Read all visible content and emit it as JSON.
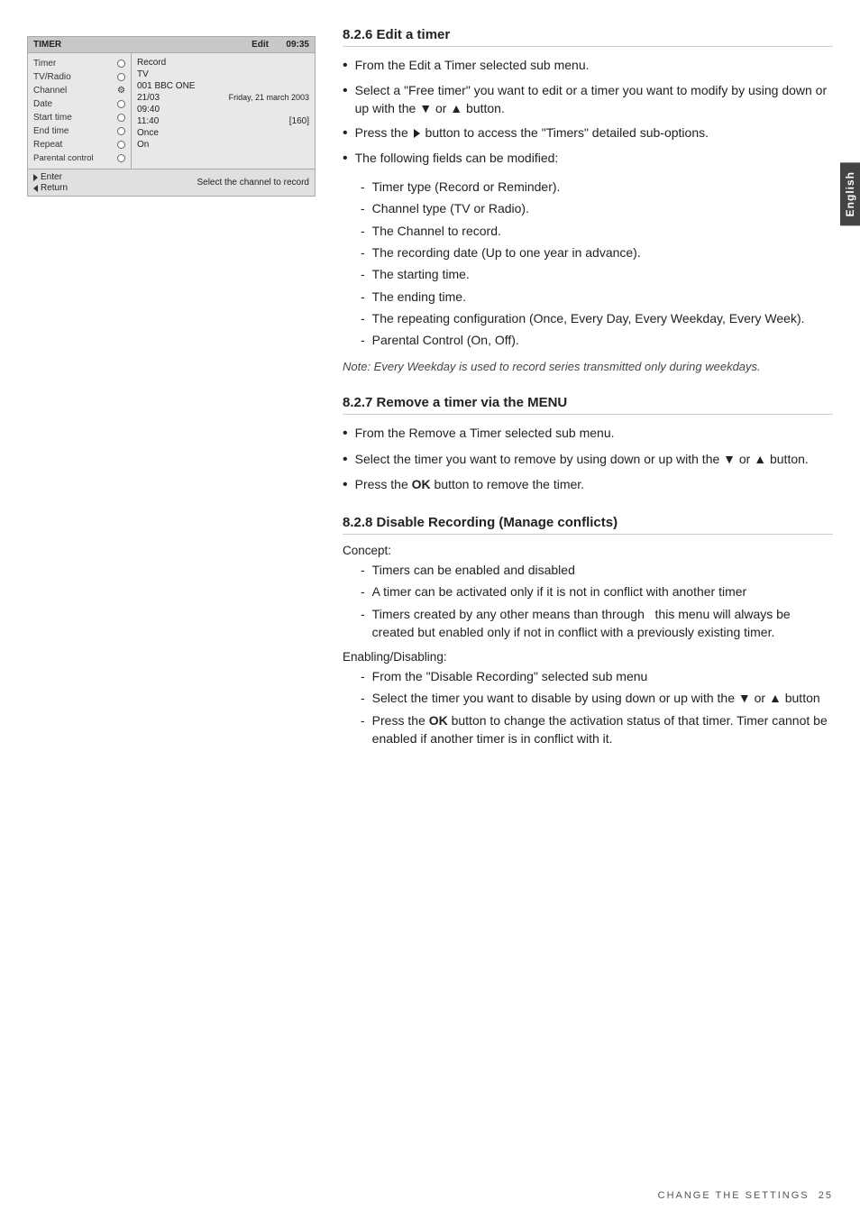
{
  "tvMenu": {
    "header": {
      "leftLabel": "TIMER",
      "rightLabel": "Edit",
      "time": "09:35"
    },
    "leftRows": [
      {
        "label": "Timer",
        "control": "radio"
      },
      {
        "label": "TV/Radio",
        "control": "radio"
      },
      {
        "label": "Channel",
        "control": "settings"
      },
      {
        "label": "Date",
        "control": "radio"
      },
      {
        "label": "Start time",
        "control": "radio"
      },
      {
        "label": "End time",
        "control": "radio"
      },
      {
        "label": "Repeat",
        "control": "radio"
      },
      {
        "label": "Parental control",
        "control": "radio"
      }
    ],
    "rightRows": [
      {
        "left": "Record",
        "right": ""
      },
      {
        "left": "TV",
        "right": ""
      },
      {
        "left": "001 BBC ONE",
        "right": ""
      },
      {
        "left": "21/03",
        "right": "Friday, 21 march 2003"
      },
      {
        "left": "09:40",
        "right": ""
      },
      {
        "left": "11:40",
        "right": "[160]"
      },
      {
        "left": "Once",
        "right": ""
      },
      {
        "left": "On",
        "right": ""
      }
    ],
    "footer": {
      "enterLabel": "Enter",
      "returnLabel": "Return",
      "hint": "Select the channel to record"
    }
  },
  "sections": {
    "s826": {
      "heading": "8.2.6   Edit a timer",
      "bullets": [
        "From the Edit a Timer selected sub menu.",
        "Select a \"Free timer\" you want to edit or a timer you want to modify by using down or up with the ▼ or ▲ button.",
        "Press the ▶ button to access the \"Timers\" detailed sub-options.",
        "The following fields can be modified:"
      ],
      "dashItems": [
        "Timer type (Record or Reminder).",
        "Channel type (TV or Radio).",
        "The Channel to record.",
        "The recording date (Up to one year in advance).",
        "The starting time.",
        "The ending time.",
        "The repeating configuration (Once, Every Day, Every Weekday, Every Week).",
        "Parental Control (On, Off)."
      ],
      "note": "Note: Every Weekday is used to record series transmitted only during weekdays."
    },
    "s827": {
      "heading": "8.2.7   Remove a timer via the MENU",
      "bullets": [
        "From the Remove a Timer selected sub menu.",
        "Select the timer you want to remove by using down or up with the ▼ or ▲ button.",
        "Press the OK button to remove the timer."
      ]
    },
    "s828": {
      "heading": "8.2.8   Disable Recording (Manage conflicts)",
      "conceptLabel": "Concept:",
      "conceptDashes": [
        "Timers can be enabled and disabled",
        "A timer can be activated only if it is not in conflict with another timer",
        "Timers created by any other means than through  this menu will always be created but enabled only if not in conflict with a previously existing timer."
      ],
      "enablingLabel": "Enabling/Disabling:",
      "enablingDashes": [
        "From the \"Disable Recording\" selected sub menu",
        "Select the timer you want to disable by using down or up with the ▼ or ▲ button",
        "Press the OK button to change the activation status of that timer. Timer cannot be enabled if another timer is in conflict with it."
      ]
    }
  },
  "footer": {
    "text": "CHANGE THE SETTINGS",
    "pageNum": "25"
  },
  "englishTab": "English"
}
